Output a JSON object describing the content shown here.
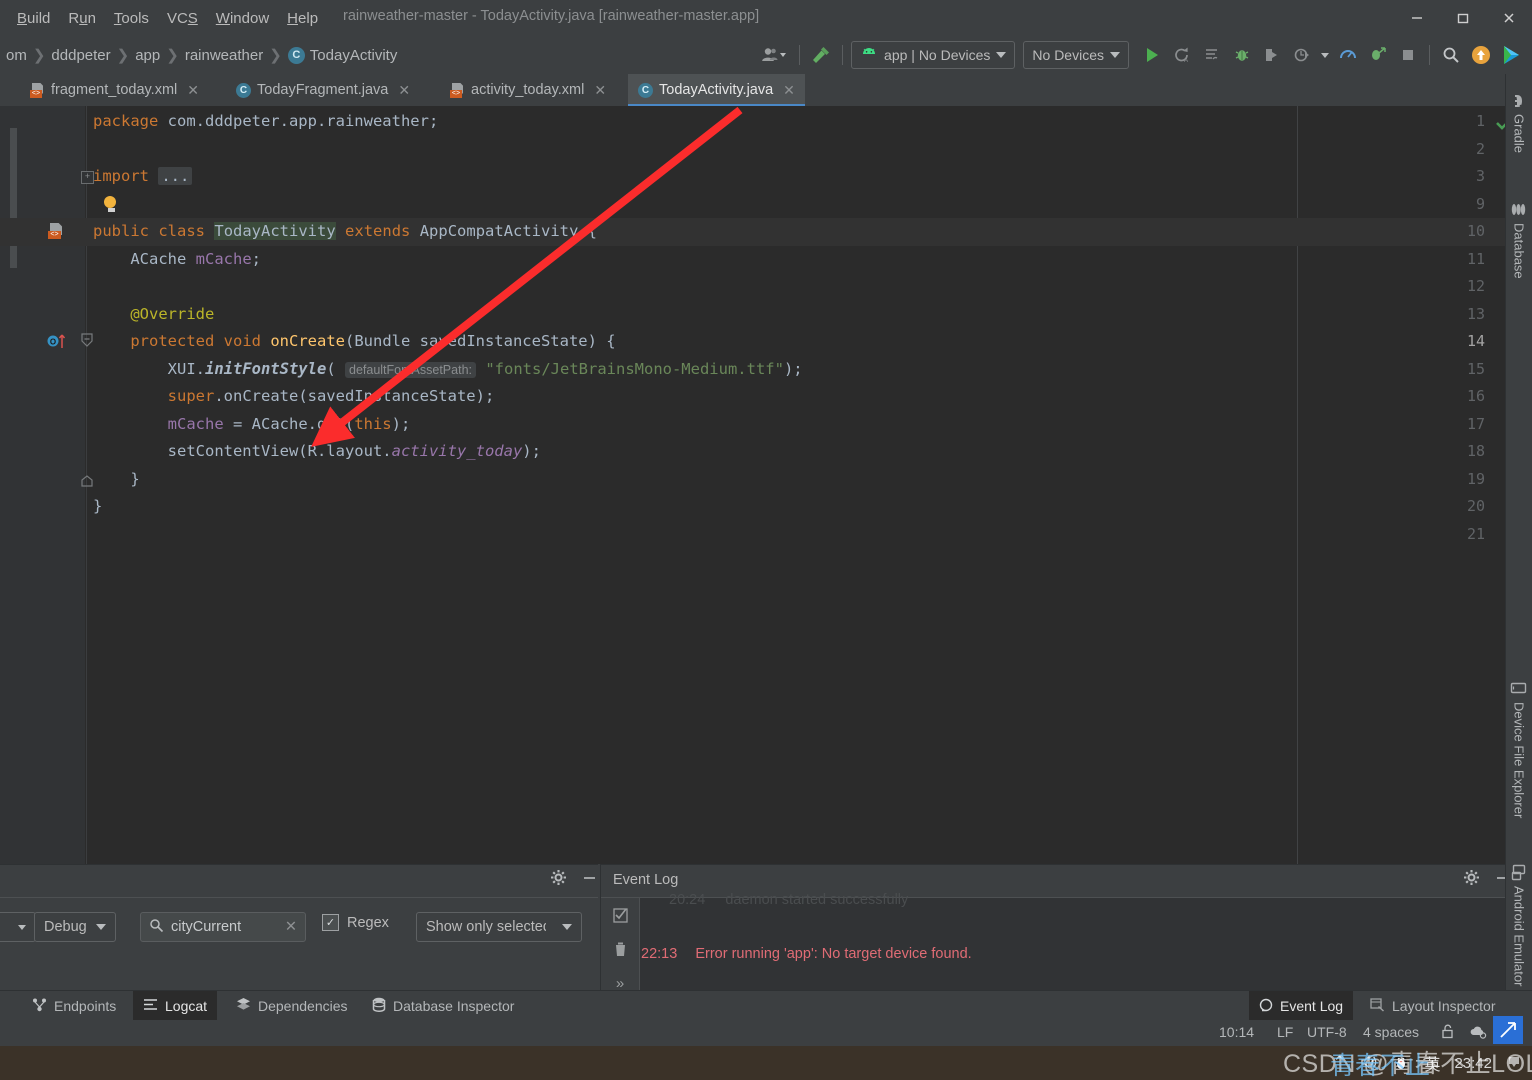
{
  "window": {
    "title": "rainweather-master - TodayActivity.java [rainweather-master.app]",
    "minimize": "—",
    "maximize": "❐",
    "close": "✕"
  },
  "menu": {
    "items": [
      "Build",
      "Run",
      "Tools",
      "VCS",
      "Window",
      "Help"
    ]
  },
  "breadcrumb": {
    "items": [
      "om",
      "dddpeter",
      "app",
      "rainweather",
      "TodayActivity"
    ],
    "class_badge": "C",
    "separator": "›"
  },
  "toolbar": {
    "profile_icon": "user-avatar-icon",
    "build_icon": "hammer-icon",
    "run_config": "app | No Devices",
    "device_select": "No Devices",
    "run": "run-icon",
    "rerun": "rerun-icon",
    "apply_changes": "apply-changes-icon",
    "debug": "debug-icon",
    "attach_debugger": "attach-debugger-icon",
    "profile": "profile-icon",
    "profiler": "profiler-icon",
    "run_with_coverage": "coverage-icon",
    "stop": "stop-icon",
    "search": "search-everywhere-icon",
    "update": "update-icon",
    "avd": "avd-manager-icon"
  },
  "tabs": [
    {
      "label": "fragment_today.xml",
      "icon": "xml-file-icon",
      "active": false,
      "close": "✕"
    },
    {
      "label": "TodayFragment.java",
      "icon": "java-class-icon",
      "active": false,
      "close": "✕"
    },
    {
      "label": "activity_today.xml",
      "icon": "xml-file-icon",
      "active": false,
      "close": "✕"
    },
    {
      "label": "TodayActivity.java",
      "icon": "java-class-icon",
      "active": true,
      "close": "✕"
    }
  ],
  "editor": {
    "filename": "TodayActivity.java",
    "line_numbers": [
      "1",
      "2",
      "3",
      "9",
      "10",
      "11",
      "12",
      "13",
      "14",
      "15",
      "16",
      "17",
      "18",
      "19",
      "20",
      "21"
    ],
    "lines": [
      {
        "n": "1",
        "text": "package com.dddpeter.app.rainweather;"
      },
      {
        "n": "2",
        "text": ""
      },
      {
        "n": "3",
        "text": "import ..."
      },
      {
        "n": "9",
        "text": ""
      },
      {
        "n": "10",
        "text": "public class TodayActivity extends AppCompatActivity {"
      },
      {
        "n": "11",
        "text": "    ACache mCache;"
      },
      {
        "n": "12",
        "text": ""
      },
      {
        "n": "13",
        "text": "    @Override"
      },
      {
        "n": "14",
        "text": "    protected void onCreate(Bundle savedInstanceState) {"
      },
      {
        "n": "15",
        "text": "        XUI.initFontStyle( defaultFontAssetPath: \"fonts/JetBrainsMono-Medium.ttf\");"
      },
      {
        "n": "16",
        "text": "        super.onCreate(savedInstanceState);"
      },
      {
        "n": "17",
        "text": "        mCache = ACache.get(this);"
      },
      {
        "n": "18",
        "text": "        setContentView(R.layout.activity_today);"
      },
      {
        "n": "19",
        "text": "    }"
      },
      {
        "n": "20",
        "text": "}"
      },
      {
        "n": "21",
        "text": ""
      }
    ],
    "tokens": {
      "kw_package": "package",
      "pkg_name": " com.dddpeter.app.rainweather;",
      "kw_import": "import",
      "import_dots": "...",
      "kw_public": "public",
      "kw_class": "class",
      "class_name": "TodayActivity",
      "kw_extends": "extends",
      "super_class": "AppCompatActivity {",
      "field_type": "ACache",
      "field_name": "mCache",
      "field_semi": ";",
      "annotation": "@Override",
      "kw_protected": "protected",
      "kw_void": "void",
      "method_name": "onCreate",
      "method_params": "(Bundle savedInstanceState) {",
      "xui_prefix": "XUI.",
      "xui_method": "initFontStyle",
      "xui_open": "(",
      "param_hint": "defaultFontAssetPath:",
      "font_path": "\"fonts/JetBrainsMono-Medium.ttf\"",
      "xui_close": ");",
      "kw_super": "super",
      "super_call": ".onCreate(savedInstanceState);",
      "mcache_assign": "mCache",
      "eq": " = ",
      "acache_get": "ACache.get(",
      "kw_this": "this",
      "acache_close": ");",
      "setcontent": "setContentView(R.layout.",
      "layout_id": "activity_today",
      "setcontent_close": ");",
      "brace_close_inner": "}",
      "brace_close_outer": "}"
    },
    "inspection_status": "no-errors-check-icon"
  },
  "logcat": {
    "panel_title": "",
    "settings_icon": "gear-icon",
    "minimize_icon": "minimize-icon",
    "level_select": "Debug",
    "search_value": "cityCurrent",
    "search_icon": "search-icon",
    "search_clear": "✕",
    "regex_label": "Regex",
    "regex_checked": true,
    "filter_select": "Show only selected"
  },
  "event_log": {
    "panel_title": "Event Log",
    "settings_icon": "gear-icon",
    "minimize_icon": "minimize-icon",
    "rail": [
      "mark-read-icon",
      "trash-icon",
      "expand-icon"
    ],
    "entries": [
      {
        "time": "20:24",
        "message": "daemon started successfully",
        "level": "info",
        "faded": true
      },
      {
        "time": "22:13",
        "message": "Error running 'app': No target device found.",
        "level": "error",
        "faded": false
      }
    ]
  },
  "bottom_tool_windows": {
    "left": [
      {
        "label": "Endpoints",
        "icon": "endpoints-icon",
        "active": false
      },
      {
        "label": "Logcat",
        "icon": "logcat-icon",
        "active": true
      },
      {
        "label": "Dependencies",
        "icon": "dependencies-icon",
        "active": false
      },
      {
        "label": "Database Inspector",
        "icon": "database-inspector-icon",
        "active": false
      }
    ],
    "right": [
      {
        "label": "Event Log",
        "icon": "event-log-icon",
        "active": true
      },
      {
        "label": "Layout Inspector",
        "icon": "layout-inspector-icon",
        "active": false
      }
    ]
  },
  "right_tool_windows": [
    {
      "label": "Gradle",
      "icon": "gradle-elephant-icon"
    },
    {
      "label": "Database",
      "icon": "database-icon"
    },
    {
      "label": "Device File Explorer",
      "icon": "device-icon"
    },
    {
      "label": "Android Emulator",
      "icon": "emulator-icon"
    }
  ],
  "status_bar": {
    "caret_position": "10:14",
    "line_separator": "LF",
    "encoding": "UTF-8",
    "indent": "4 spaces",
    "lock_icon": "unlocked-icon",
    "sync_icon": "cloud-sync-icon"
  },
  "taskbar": {
    "chevron": "⌃",
    "volume_icon": "speaker-icon",
    "qq_icon": "penguin-icon",
    "ime": "英",
    "clock": "23:42",
    "watermark": "CSDN @青春不止LOL和群",
    "watermark_overlay": "青春不止"
  },
  "colors": {
    "chrome": "#3c3f41",
    "editor_bg": "#2b2b2b",
    "gutter_bg": "#313335",
    "keyword": "#cc7832",
    "string": "#6a8759",
    "field": "#9876aa",
    "annotation": "#bbb529",
    "method": "#ffc66d",
    "text": "#a9b7c6",
    "accent_blue": "#4a88c7",
    "error_red": "#e06c75",
    "arrow_red": "#fb2c2c",
    "green": "#499c54"
  }
}
